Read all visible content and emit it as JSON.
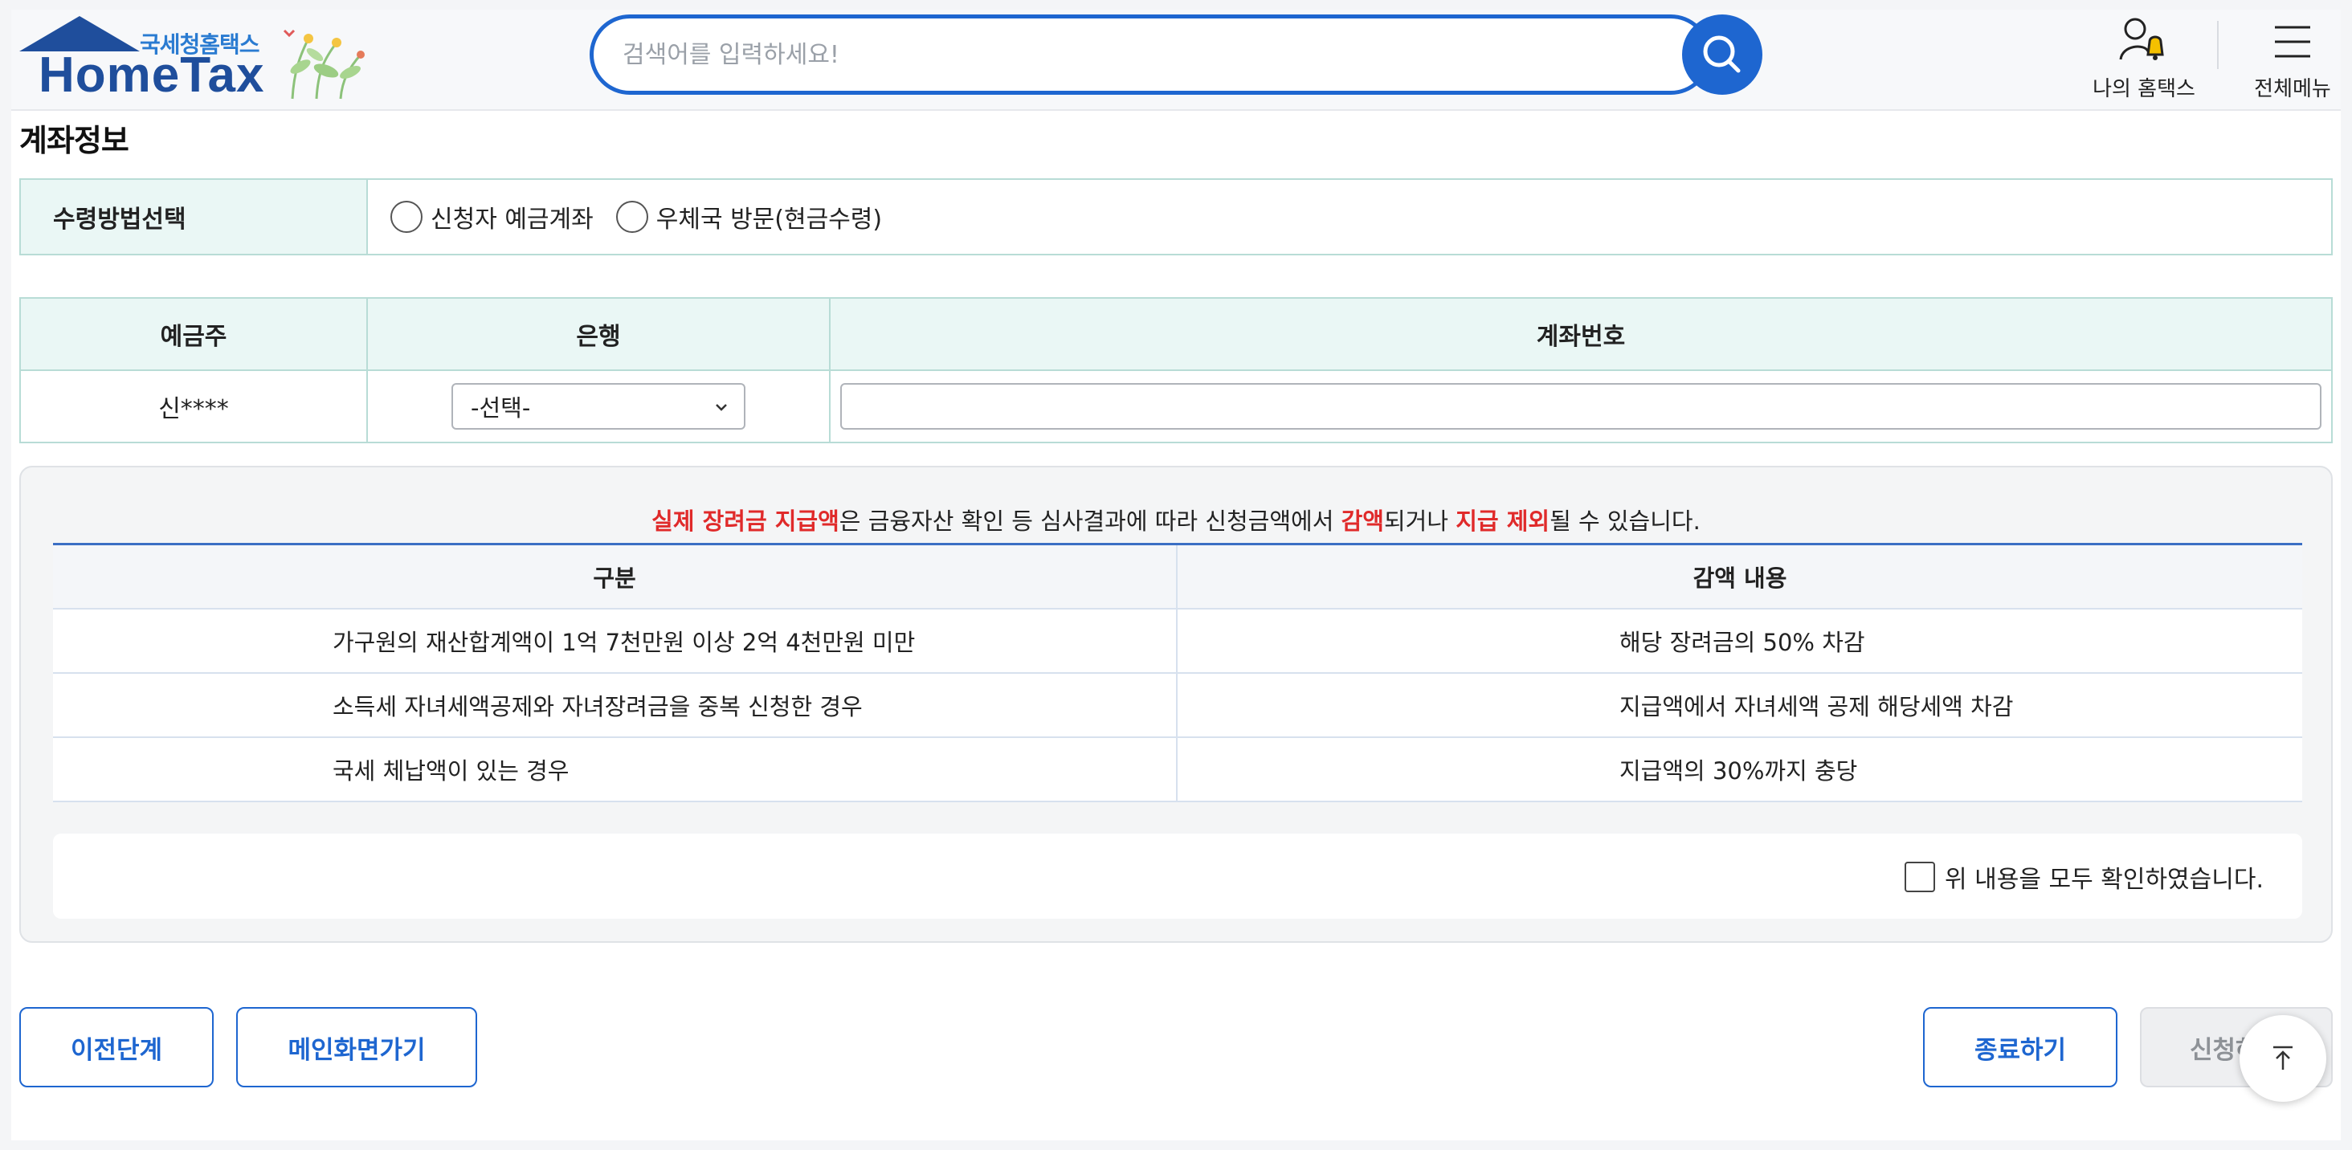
{
  "header": {
    "logo_org": "국세청홈택스",
    "logo_brand": "HomeTax",
    "search_placeholder": "검색어를 입력하세요!",
    "my_hometax_label": "나의 홈택스",
    "all_menu_label": "전체메뉴"
  },
  "section_title": "계좌정보",
  "receive_method": {
    "label": "수령방법선택",
    "options": [
      "신청자 예금계좌",
      "우체국 방문(현금수령)"
    ]
  },
  "account_table": {
    "headers": [
      "예금주",
      "은행",
      "계좌번호"
    ],
    "holder": "신****",
    "bank_selected": "-선택-",
    "account_number": ""
  },
  "notice": {
    "message_parts": [
      {
        "text": "실제 장려금 지급액",
        "red": true
      },
      {
        "text": "은 금융자산 확인 등 심사결과에 따라 신청금액에서 ",
        "red": false
      },
      {
        "text": "감액",
        "red": true
      },
      {
        "text": "되거나 ",
        "red": false
      },
      {
        "text": "지급 제외",
        "red": true
      },
      {
        "text": "될 수 있습니다.",
        "red": false
      }
    ],
    "table_headers": [
      "구분",
      "감액 내용"
    ],
    "rows": [
      {
        "category": "가구원의 재산합계액이 1억 7천만원 이상 2억 4천만원 미만",
        "reduction": "해당 장려금의 50% 차감"
      },
      {
        "category": "소득세 자녀세액공제와 자녀장려금을 중복 신청한 경우",
        "reduction": "지급액에서 자녀세액 공제 해당세액 차감"
      },
      {
        "category": "국세 체납액이 있는 경우",
        "reduction": "지급액의 30%까지 충당"
      }
    ],
    "confirm_label": "위 내용을 모두 확인하였습니다."
  },
  "buttons": {
    "prev": "이전단계",
    "main": "메인화면가기",
    "close": "종료하기",
    "apply": "신청하기"
  },
  "colors": {
    "primary": "#1e66d0",
    "brand": "#1f4e9c",
    "highlight_red": "#e02a2a",
    "table_header_bg": "#eaf7f5",
    "table_border": "#b8dcd6"
  },
  "icons": [
    "search-icon",
    "user-bell-icon",
    "hamburger-menu-icon",
    "chevron-down-icon",
    "scroll-top-icon"
  ]
}
